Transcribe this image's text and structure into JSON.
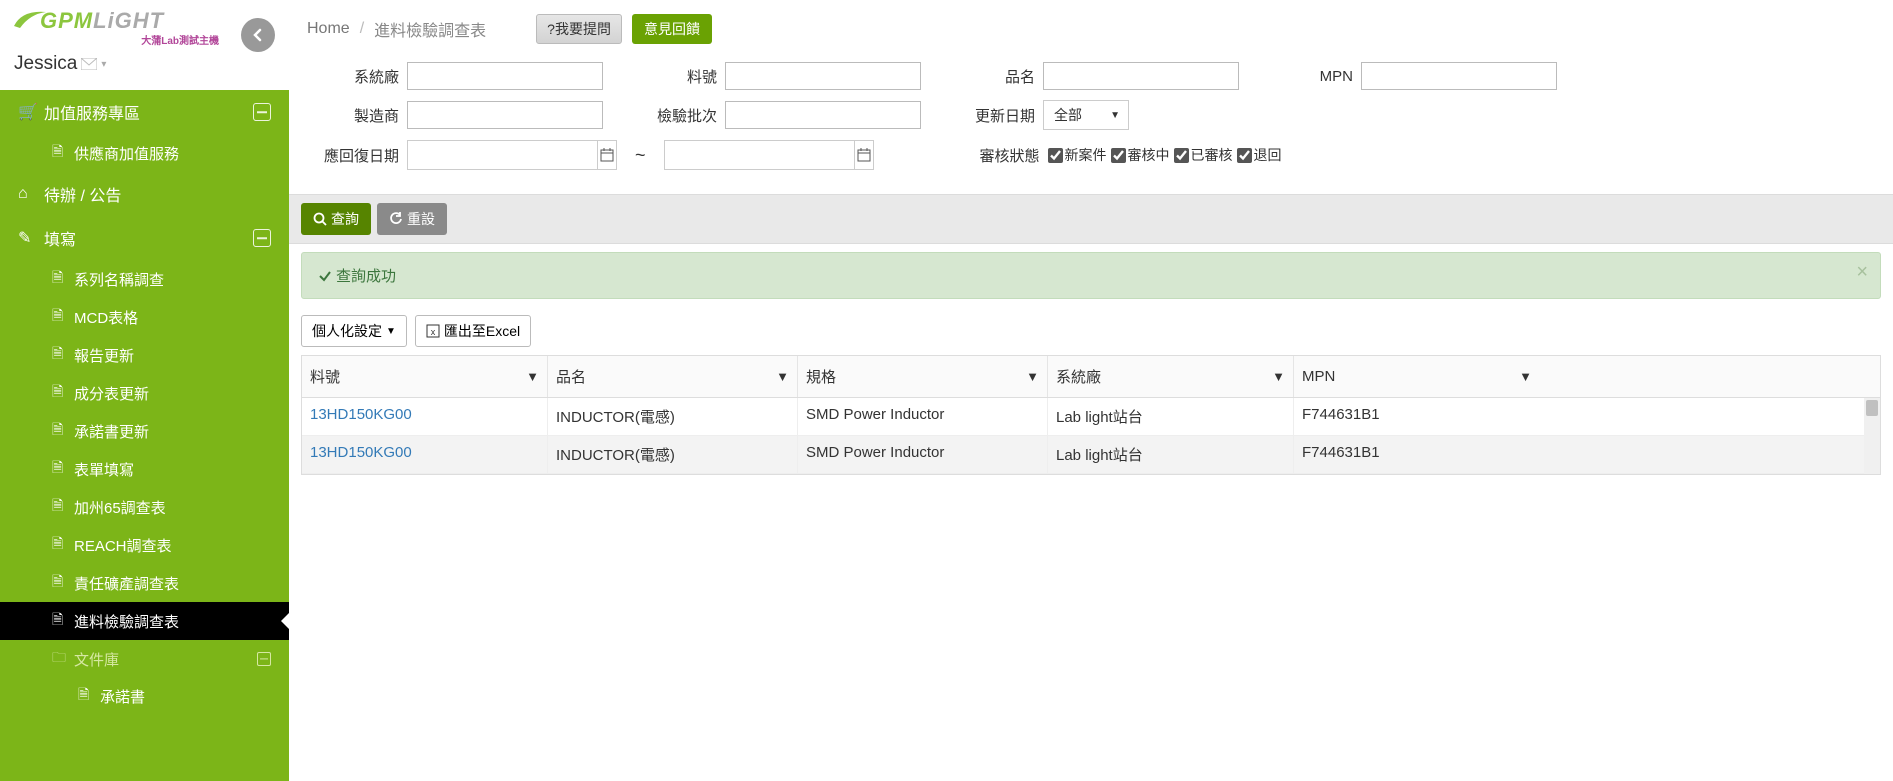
{
  "logo": {
    "main": "GPM",
    "light": "LiGHT",
    "sub": "大蒲Lab測試主機"
  },
  "user": {
    "name": "Jessica"
  },
  "nav": {
    "group_addon": "加值服務專區",
    "item_vendor_addon": "供應商加值服務",
    "group_todo": "待辦 / 公告",
    "group_fill": "填寫",
    "items": {
      "series_name": "系列名稱調查",
      "mcd": "MCD表格",
      "report_update": "報告更新",
      "composition_update": "成分表更新",
      "commitment_update": "承諾書更新",
      "form_fill": "表單填寫",
      "ca65": "加州65調查表",
      "reach": "REACH調查表",
      "conflict": "責任礦產調查表",
      "incoming": "進料檢驗調查表",
      "doclib": "文件庫",
      "commitment_doc": "承諾書"
    }
  },
  "breadcrumb": {
    "home": "Home",
    "current": "進料檢驗調查表"
  },
  "buttons": {
    "ask": "?我要提問",
    "feedback": "意見回饋",
    "search": "查詢",
    "reset": "重設",
    "personalize": "個人化設定",
    "export": "匯出至Excel"
  },
  "filters": {
    "system_factory": "系統廠",
    "part_no": "料號",
    "product_name": "品名",
    "mpn": "MPN",
    "manufacturer": "製造商",
    "inspection_batch": "檢驗批次",
    "update_date": "更新日期",
    "update_date_val": "全部",
    "reply_date": "應回復日期",
    "tilde": "~",
    "review_status": "審核狀態",
    "status_new": "新案件",
    "status_reviewing": "審核中",
    "status_reviewed": "已審核",
    "status_returned": "退回"
  },
  "alert": {
    "text": "查詢成功"
  },
  "grid": {
    "headers": {
      "part_no": "料號",
      "product_name": "品名",
      "spec": "規格",
      "system_factory": "系統廠",
      "mpn": "MPN"
    },
    "rows": [
      {
        "part_no": "13HD150KG00",
        "product_name": "INDUCTOR(電感)",
        "spec": "SMD Power Inductor",
        "system_factory": "Lab light站台",
        "mpn": "F744631B1"
      },
      {
        "part_no": "13HD150KG00",
        "product_name": "INDUCTOR(電感)",
        "spec": "SMD Power Inductor",
        "system_factory": "Lab light站台",
        "mpn": "F744631B1"
      }
    ]
  }
}
